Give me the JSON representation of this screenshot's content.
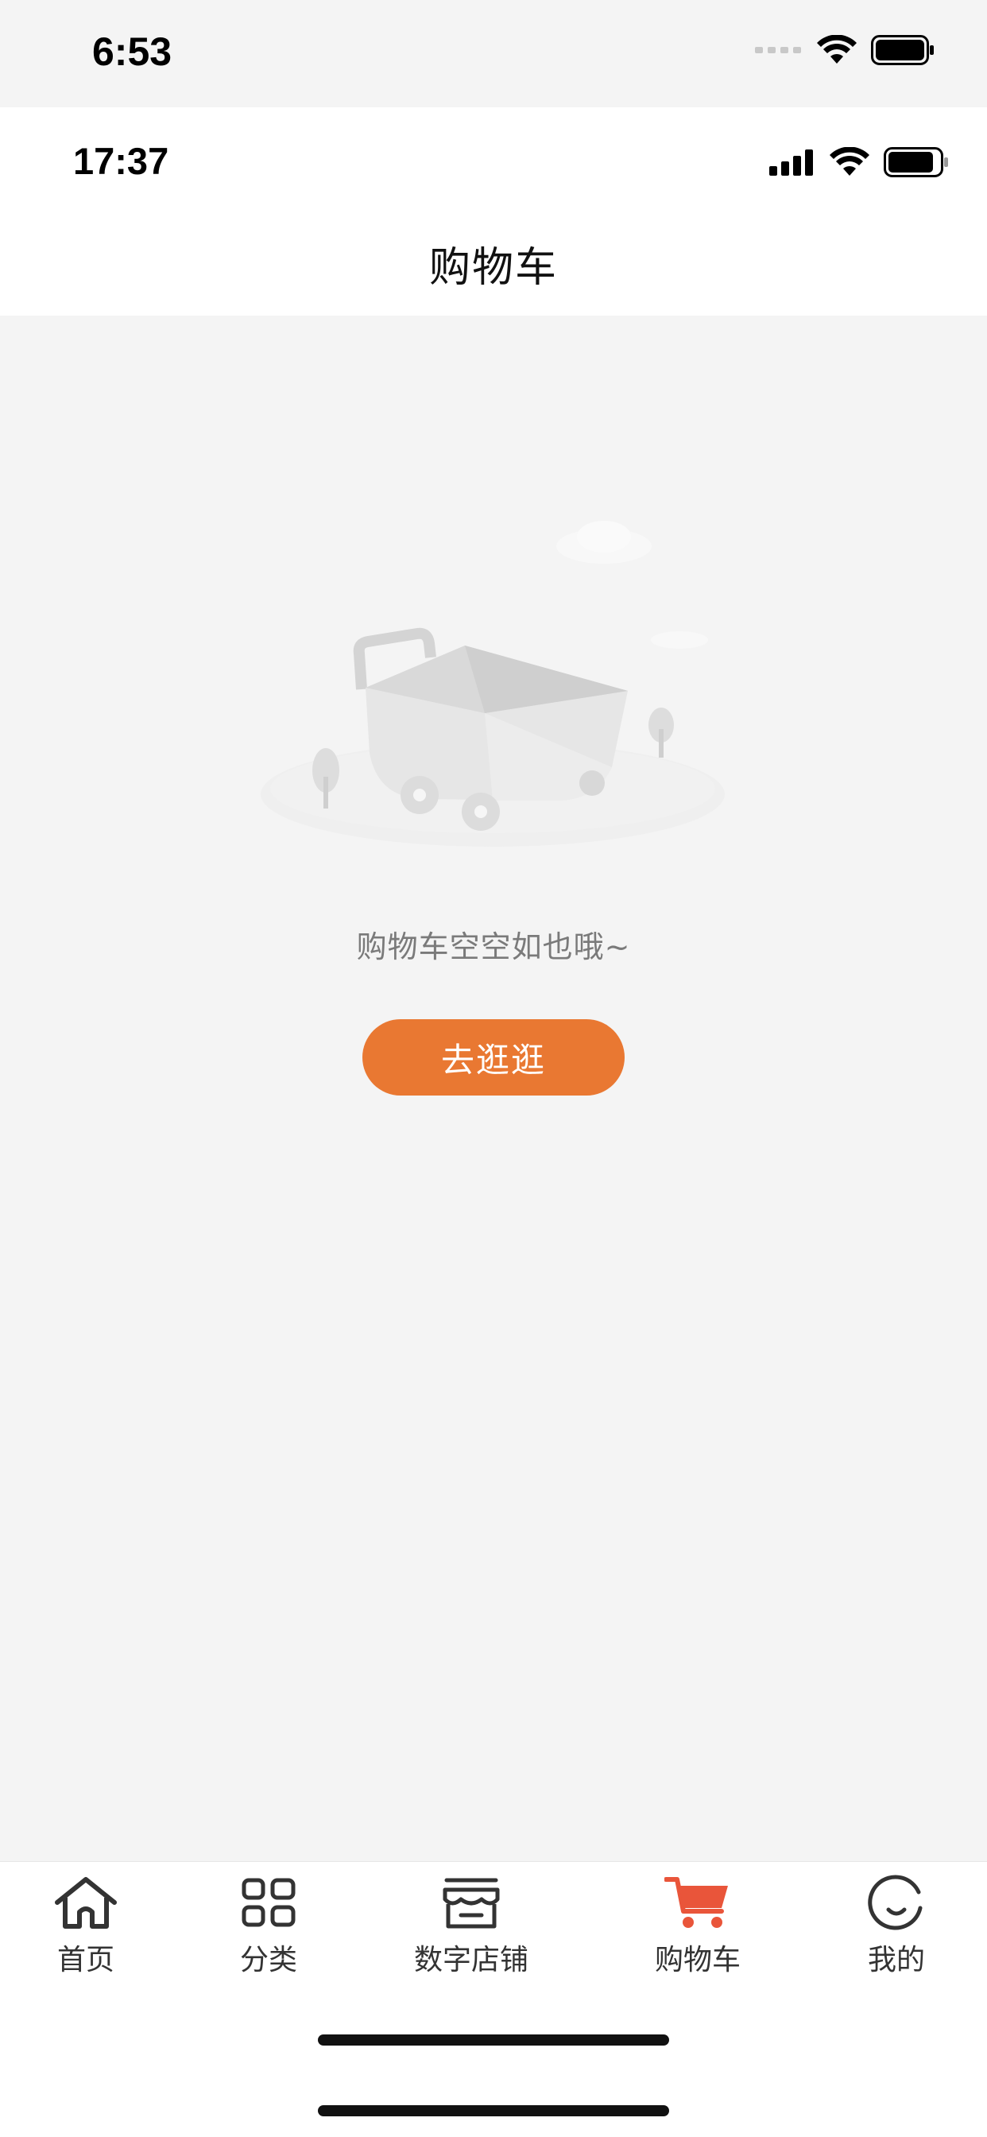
{
  "outer_status": {
    "time": "6:53"
  },
  "inner_status": {
    "time": "17:37"
  },
  "nav": {
    "title": "购物车"
  },
  "empty": {
    "message": "购物车空空如也哦~",
    "button_label": "去逛逛"
  },
  "tabbar": {
    "active_color": "#e9553a",
    "items": [
      {
        "label": "首页",
        "icon": "home-icon",
        "active": false
      },
      {
        "label": "分类",
        "icon": "category-grid-icon",
        "active": false
      },
      {
        "label": "数字店铺",
        "icon": "store-icon",
        "active": false
      },
      {
        "label": "购物车",
        "icon": "cart-icon",
        "active": true
      },
      {
        "label": "我的",
        "icon": "smile-icon",
        "active": false
      }
    ]
  },
  "colors": {
    "accent": "#e97832",
    "background": "#f4f4f4"
  }
}
